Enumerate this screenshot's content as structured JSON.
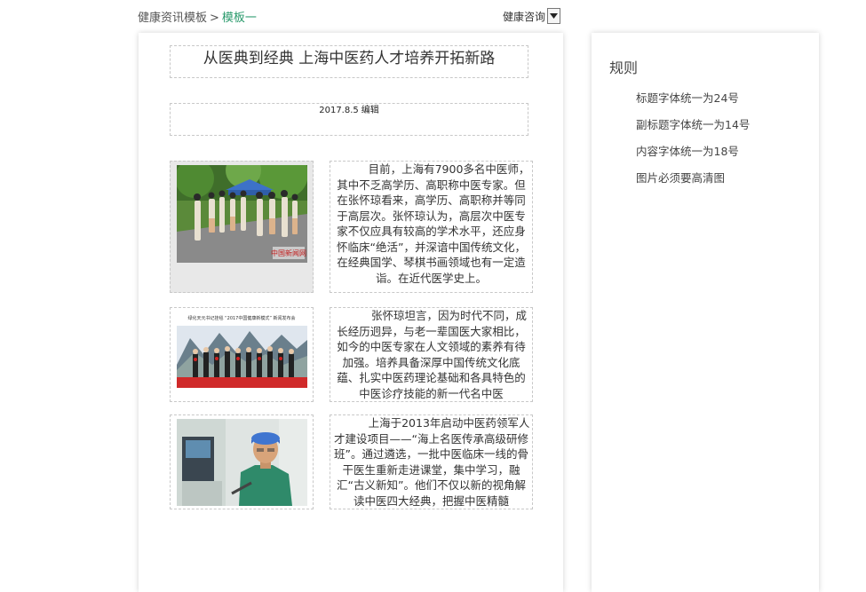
{
  "breadcrumb": {
    "parent": "健康资讯模板",
    "separator": ">",
    "current": "模板一"
  },
  "category_select": {
    "selected": "健康咨询"
  },
  "article": {
    "title": "从医典到经典 上海中医药人才培养开拓新路",
    "date": "2017.8.5",
    "action": "编辑",
    "sections": [
      {
        "image_desc": "group-photo",
        "text": "目前，上海有7900多名中医师，其中不乏高学历、高职称中医专家。但在张怀琼看来，高学历、高职称并等同于高层次。张怀琼认为，高层次中医专家不仅应具有较高的学术水平，还应身怀临床“绝活”，并深谙中国传统文化，在经典国学、琴棋书画领域也有一定造诣。在近代医学史上。"
      },
      {
        "image_desc": "ceremony-photo",
        "text": "张怀琼坦言，因为时代不同，成长经历迥异，与老一辈国医大家相比，如今的中医专家在人文领域的素养有待加强。培养具备深厚中国传统文化底蕴、扎实中医药理论基础和各具特色的中医诊疗技能的新一代名中医"
      },
      {
        "image_desc": "doctor-photo",
        "text": "上海于2013年启动中医药领军人才建设项目——“海上名医传承高级研修班”。通过遴选，一批中医临床一线的骨干医生重新走进课堂，集中学习，融汇“古义新知”。他们不仅以新的视角解读中医四大经典，把握中医精髓"
      }
    ]
  },
  "sidebar": {
    "title": "规则",
    "rules": [
      "标题字体统一为24号",
      "副标题字体统一为14号",
      "内容字体统一为18号",
      "图片必须要高清图"
    ]
  },
  "watermark": "中国新闻网",
  "banner_text": "绿化天元书记挂毯 “2017中国健康新模式” 新闻发布会"
}
